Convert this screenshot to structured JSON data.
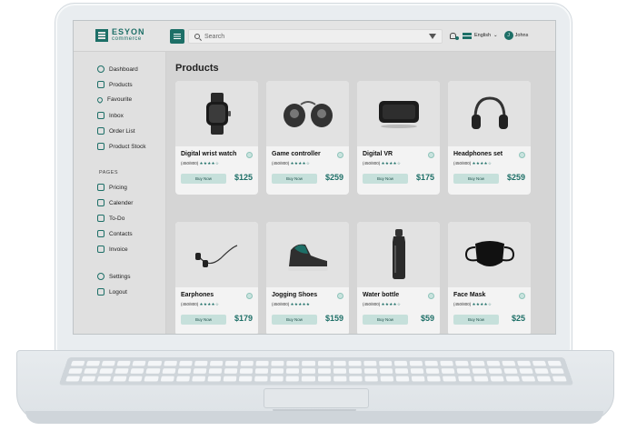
{
  "brand": {
    "name": "ESYON",
    "tagline": "commerce"
  },
  "topbar": {
    "search_placeholder": "Search",
    "language": "English",
    "user": "Johns",
    "user_initial": "J",
    "accent": "#1d6f67"
  },
  "sidebar": {
    "main": [
      {
        "label": "Dashboard",
        "icon": "gauge-icon"
      },
      {
        "label": "Products",
        "icon": "grid-icon"
      },
      {
        "label": "Favourite",
        "icon": "heart-icon"
      },
      {
        "label": "Inbox",
        "icon": "inbox-icon"
      },
      {
        "label": "Order List",
        "icon": "list-icon"
      },
      {
        "label": "Product Stock",
        "icon": "stock-icon"
      }
    ],
    "pages_heading": "PAGES",
    "pages": [
      {
        "label": "Pricing",
        "icon": "tag-icon"
      },
      {
        "label": "Calender",
        "icon": "calendar-icon"
      },
      {
        "label": "To-Do",
        "icon": "todo-icon"
      },
      {
        "label": "Contacts",
        "icon": "contacts-icon"
      },
      {
        "label": "Invoice",
        "icon": "invoice-icon"
      }
    ],
    "bottom": [
      {
        "label": "Settings",
        "icon": "gear-icon"
      },
      {
        "label": "Logout",
        "icon": "logout-icon"
      }
    ]
  },
  "main": {
    "title": "Products",
    "products": [
      {
        "name": "Digital wrist watch",
        "rating_count": "(450/800)",
        "stars": "★★★★☆",
        "buy_label": "Buy Now",
        "price": "$125",
        "icon": "watch-icon"
      },
      {
        "name": "Game controller",
        "rating_count": "(450/800)",
        "stars": "★★★★☆",
        "buy_label": "Buy Now",
        "price": "$259",
        "icon": "controller-icon"
      },
      {
        "name": "Digital VR",
        "rating_count": "(450/800)",
        "stars": "★★★★☆",
        "buy_label": "Buy Now",
        "price": "$175",
        "icon": "vr-headset-icon"
      },
      {
        "name": "Headphones set",
        "rating_count": "(450/800)",
        "stars": "★★★★☆",
        "buy_label": "Buy Now",
        "price": "$259",
        "icon": "headphones-icon"
      },
      {
        "name": "Earphones",
        "rating_count": "(450/800)",
        "stars": "★★★★☆",
        "buy_label": "Buy Now",
        "price": "$179",
        "icon": "earphones-icon"
      },
      {
        "name": "Jogging Shoes",
        "rating_count": "(450/800)",
        "stars": "★★★★★",
        "buy_label": "Buy Now",
        "price": "$159",
        "icon": "shoe-icon"
      },
      {
        "name": "Water bottle",
        "rating_count": "(450/800)",
        "stars": "★★★★☆",
        "buy_label": "Buy Now",
        "price": "$59",
        "icon": "bottle-icon"
      },
      {
        "name": "Face Mask",
        "rating_count": "(450/800)",
        "stars": "★★★★☆",
        "buy_label": "Buy Now",
        "price": "$25",
        "icon": "mask-icon"
      }
    ]
  }
}
